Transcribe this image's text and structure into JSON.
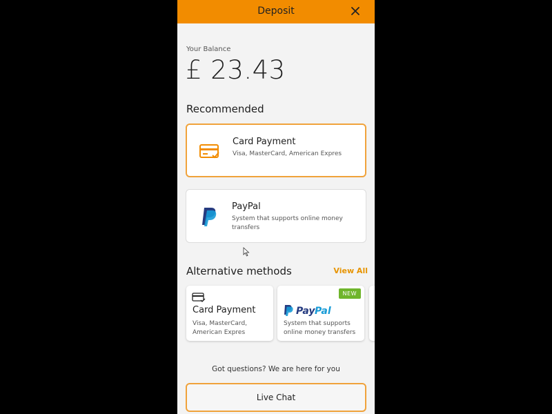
{
  "header": {
    "title": "Deposit",
    "close_icon": "close-icon"
  },
  "balance": {
    "label": "Your Balance",
    "amount": "£ 23.43"
  },
  "recommended": {
    "title": "Recommended",
    "items": [
      {
        "title": "Card Payment",
        "description": "Visa, MasterCard, American Expres",
        "icon": "card-icon",
        "selected": true
      },
      {
        "title": "PayPal",
        "description": "System that supports online money transfers",
        "icon": "paypal-icon",
        "selected": false
      }
    ]
  },
  "alternative": {
    "title": "Alternative methods",
    "view_all": "View All",
    "items": [
      {
        "title": "Card Payment",
        "description": "Visa, MasterCard, American Expres",
        "icon": "card-icon"
      },
      {
        "title": "PayPal",
        "description": "System that supports online money transfers",
        "icon": "paypal-logo",
        "badge": "NEW"
      }
    ]
  },
  "footer": {
    "questions": "Got questions? We are here for you",
    "live_chat": "Live Chat"
  },
  "colors": {
    "accent": "#f28c00",
    "badge": "#6fb52b",
    "paypal_dark": "#253b80",
    "paypal_light": "#179bd7"
  }
}
